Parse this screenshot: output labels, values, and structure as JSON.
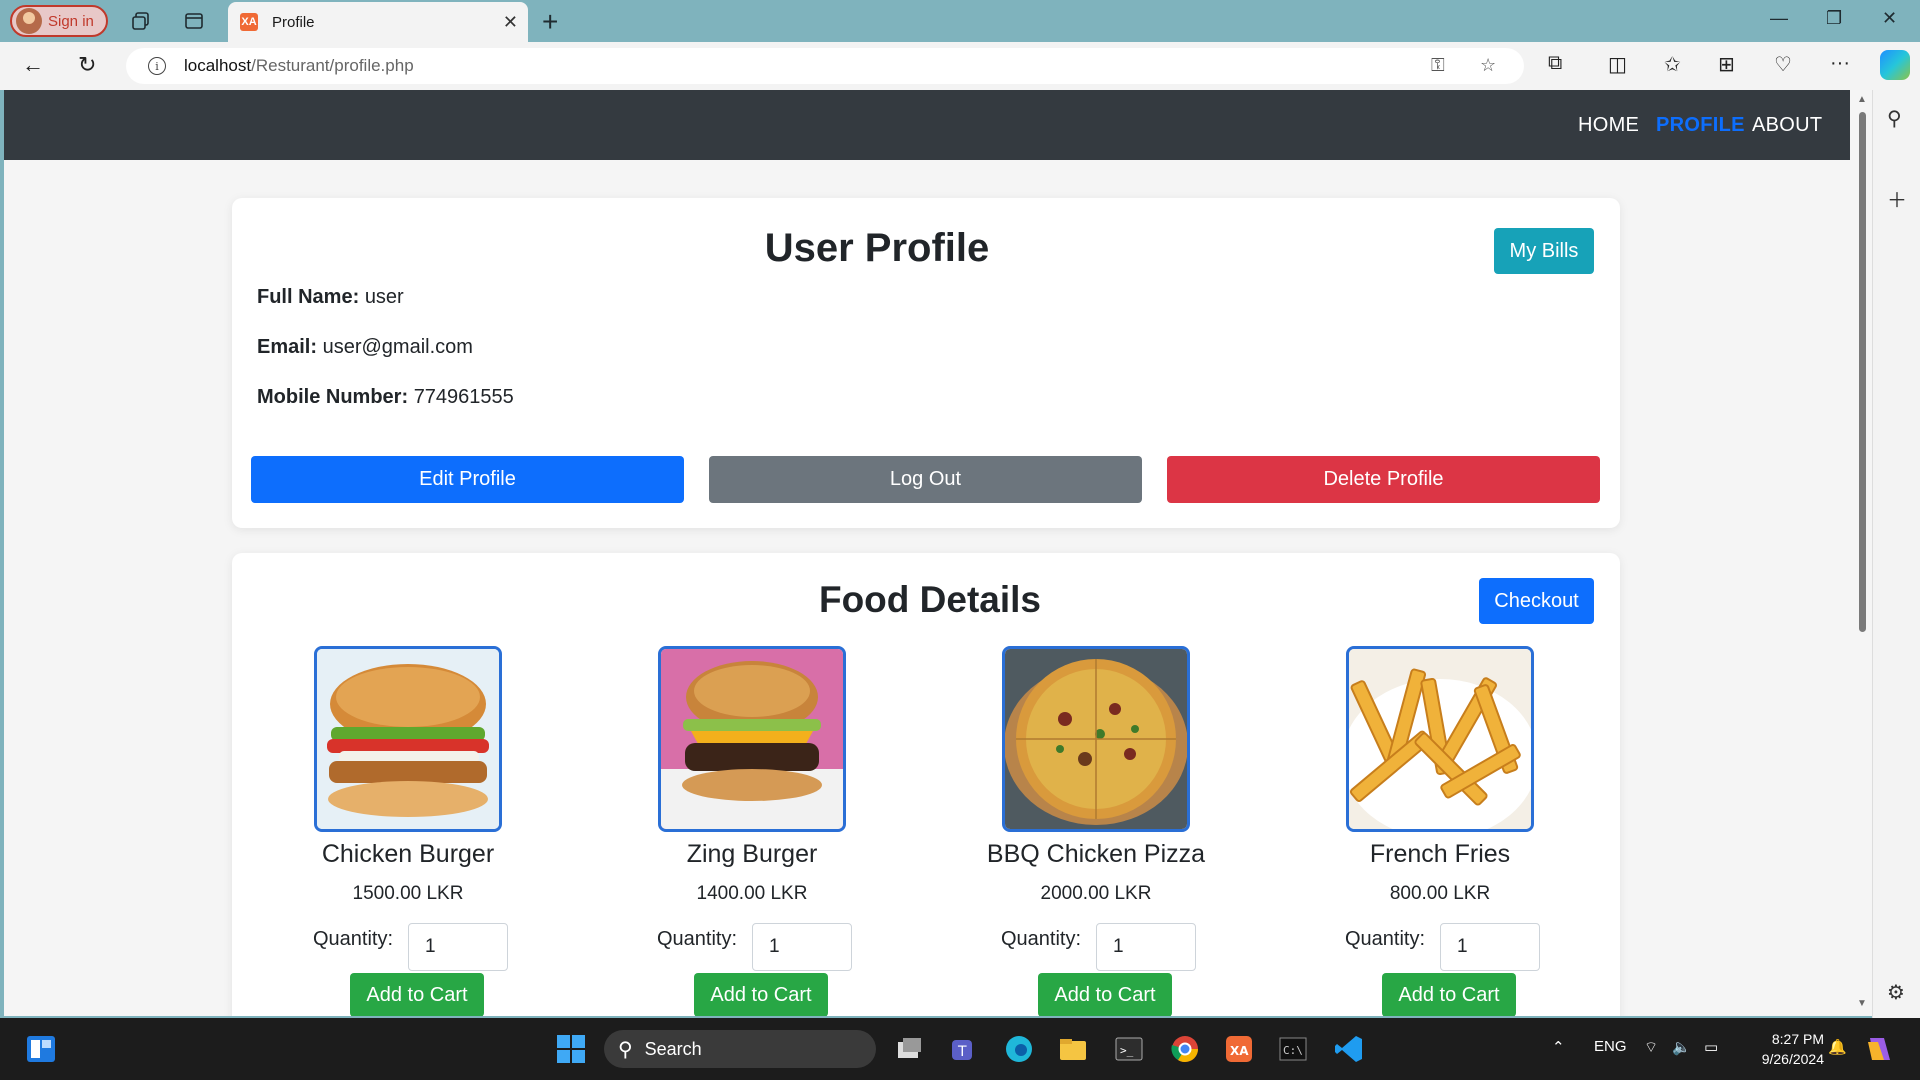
{
  "browser": {
    "signin_label": "Sign in",
    "tab_title": "Profile",
    "favicon_text": "XA",
    "url_host": "localhost",
    "url_path": "/Resturant/profile.php"
  },
  "nav": {
    "items": [
      "HOME",
      "PROFILE",
      "ABOUT"
    ],
    "active": "PROFILE",
    "active_color": "#0d6efd"
  },
  "profile": {
    "title": "User Profile",
    "my_bills_label": "My Bills",
    "full_name_label": "Full Name:",
    "full_name": "user",
    "email_label": "Email:",
    "email": "user@gmail.com",
    "mobile_label": "Mobile Number:",
    "mobile": "774961555",
    "edit_label": "Edit Profile",
    "logout_label": "Log Out",
    "delete_label": "Delete Profile"
  },
  "food": {
    "title": "Food Details",
    "checkout_label": "Checkout",
    "quantity_label": "Quantity:",
    "add_to_cart_label": "Add to Cart",
    "items": [
      {
        "name": "Chicken Burger",
        "price": "1500.00 LKR",
        "qty": "1"
      },
      {
        "name": "Zing Burger",
        "price": "1400.00 LKR",
        "qty": "1"
      },
      {
        "name": "BBQ Chicken Pizza",
        "price": "2000.00 LKR",
        "qty": "1"
      },
      {
        "name": "French Fries",
        "price": "800.00 LKR",
        "qty": "1"
      }
    ]
  },
  "taskbar": {
    "search_label": "Search",
    "lang": "ENG",
    "time": "8:27 PM",
    "date": "9/26/2024"
  }
}
